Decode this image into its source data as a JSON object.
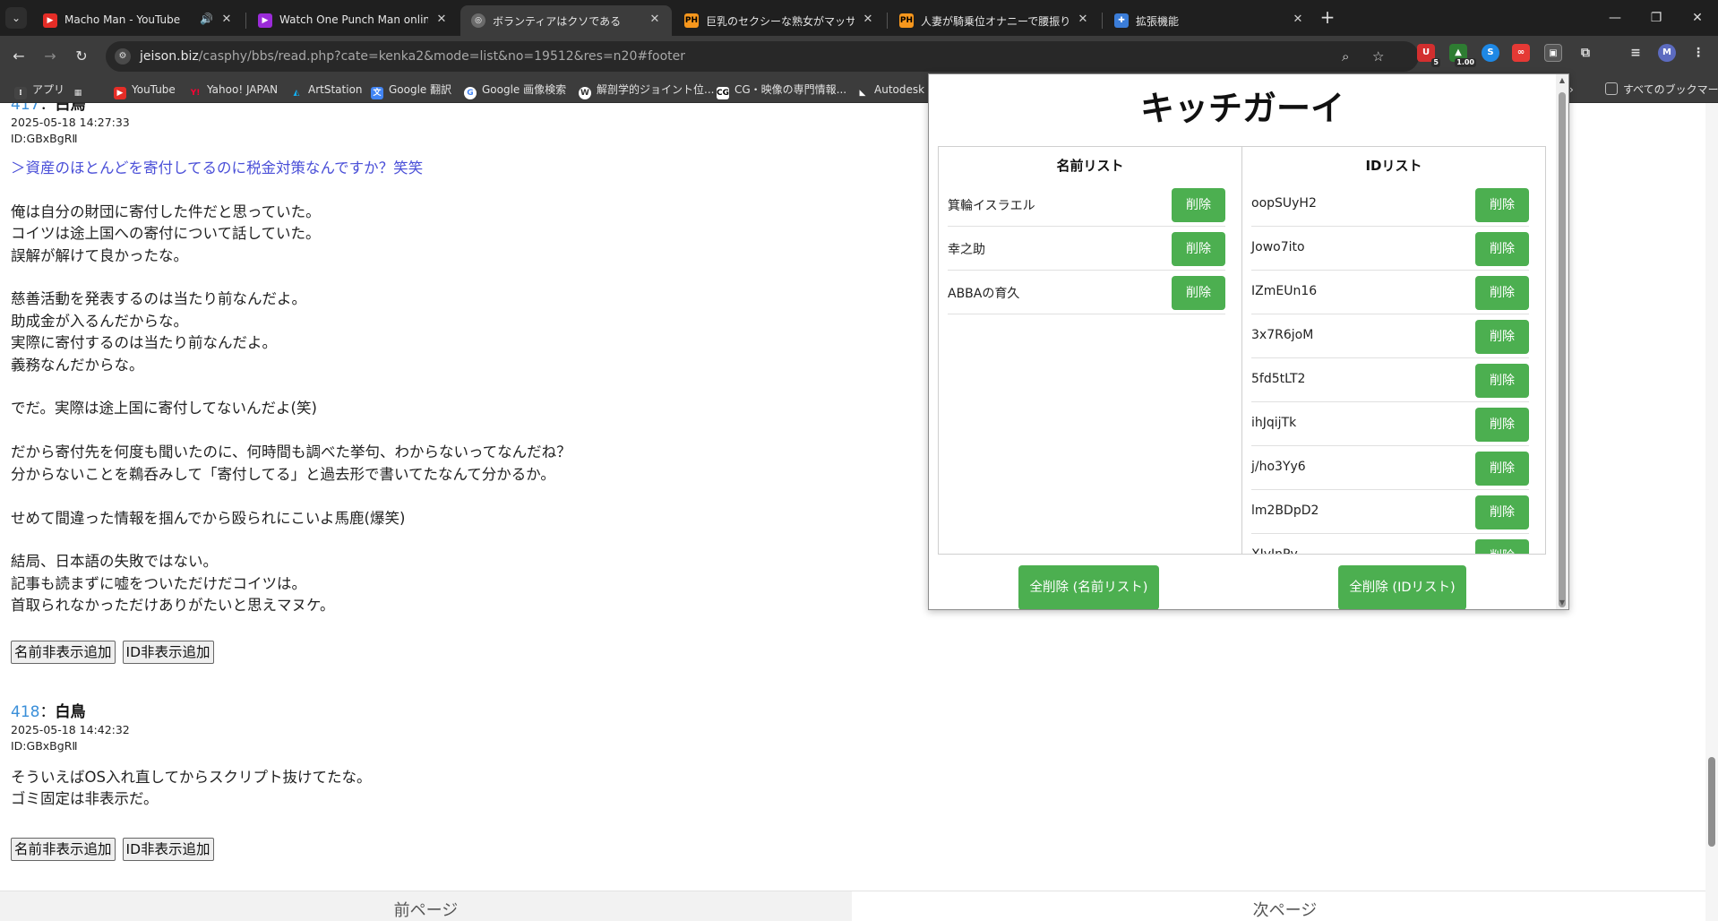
{
  "browser": {
    "tabs": [
      {
        "title": "Macho Man - YouTube",
        "icon": "youtube-icon",
        "active": false
      },
      {
        "title": "Watch One Punch Man online f",
        "icon": "play-icon",
        "active": false
      },
      {
        "title": "ボランティアはクソである",
        "icon": "globe-icon",
        "active": true
      },
      {
        "title": "巨乳のセクシーな熟女がマッサージ師",
        "icon": "ph-icon",
        "active": false
      },
      {
        "title": "人妻が騎乗位オナニーで腰振りまく",
        "icon": "ph-icon",
        "active": false
      },
      {
        "title": "拡張機能",
        "icon": "puzzle-icon",
        "active": false
      }
    ],
    "new_tab": "+",
    "url_host": "jeison.biz",
    "url_path": "/casphy/bbs/read.php?cate=kenka2&mode=list&no=19512&res=n20#footer",
    "ext_badge_1": "5",
    "ext_badge_2": "1.00",
    "profile_initial": "M",
    "bookmarks": [
      {
        "label": "アプリ",
        "icon": "apps-icon"
      },
      {
        "label": "",
        "icon": "grid-icon"
      },
      {
        "label": "YouTube",
        "icon": "youtube-icon"
      },
      {
        "label": "Yahoo! JAPAN",
        "icon": "yahoo-icon"
      },
      {
        "label": "ArtStation",
        "icon": "artstation-icon"
      },
      {
        "label": "Google 翻訳",
        "icon": "translate-icon"
      },
      {
        "label": "Google 画像検索",
        "icon": "google-icon"
      },
      {
        "label": "解剖学的ジョイント位...",
        "icon": "wordpress-icon"
      },
      {
        "label": "CG・映像の専門情報...",
        "icon": "cg-icon"
      },
      {
        "label": "Autodesk C",
        "icon": "autodesk-icon"
      }
    ],
    "all_bookmarks": "すべてのブックマーク"
  },
  "posts": [
    {
      "number": "417",
      "name": "白鳥",
      "date": "2025-05-18 14:27:33",
      "id": "ID:GBxBgRⅡ",
      "quote": "＞資産のほとんどを寄付してるのに税金対策なんですか？笑笑",
      "body": "俺は自分の財団に寄付した件だと思っていた。\nコイツは途上国への寄付について話していた。\n誤解が解けて良かったな。\n\n慈善活動を発表するのは当たり前なんだよ。\n助成金が入るんだからな。\n実際に寄付するのは当たり前なんだよ。\n義務なんだからな。\n\nでだ。実際は途上国に寄付してないんだよ(笑)\n\nだから寄付先を何度も聞いたのに、何時間も調べた挙句、わからないってなんだね？\n分からないことを鵜呑みして「寄付してる」と過去形で書いてたなんて分かるか。\n\nせめて間違った情報を掴んでから殴られにこいよ馬鹿(爆笑)\n\n結局、日本語の失敗ではない。\n記事も読まずに嘘をついただけだコイツは。\n首取られなかっただけありがたいと思えマヌケ。",
      "hide_name_btn": "名前非表示追加",
      "hide_id_btn": "ID非表示追加"
    },
    {
      "number": "418",
      "name": "白鳥",
      "date": "2025-05-18 14:42:32",
      "id": "ID:GBxBgRⅡ",
      "quote": "",
      "body": "そういえばOS入れ直してからスクリプト抜けてたな。\nゴミ固定は非表示だ。",
      "hide_name_btn": "名前非表示追加",
      "hide_id_btn": "ID非表示追加"
    }
  ],
  "pager": {
    "prev": "前ページ",
    "next": "次ページ"
  },
  "popup": {
    "title": "キッチガーイ",
    "name_list_header": "名前リスト",
    "id_list_header": "IDリスト",
    "delete_label": "削除",
    "name_list": [
      "箕輪イスラエル",
      "幸之助",
      "ABBAの育久"
    ],
    "id_list": [
      "oopSUyH2",
      "Jowo7ito",
      "IZmEUn16",
      "3x7R6joM",
      "5fd5tLT2",
      "ihJqijTk",
      "j/ho3Yy6",
      "lm2BDpD2",
      "XJyJnPy"
    ],
    "clear_name_btn": "全削除 (名前リスト)",
    "clear_id_btn": "全削除 (IDリスト)"
  },
  "colors": {
    "accent_green": "#4caf50",
    "link_blue": "#3a8fd9",
    "quote_blue": "#4a4fd8"
  }
}
